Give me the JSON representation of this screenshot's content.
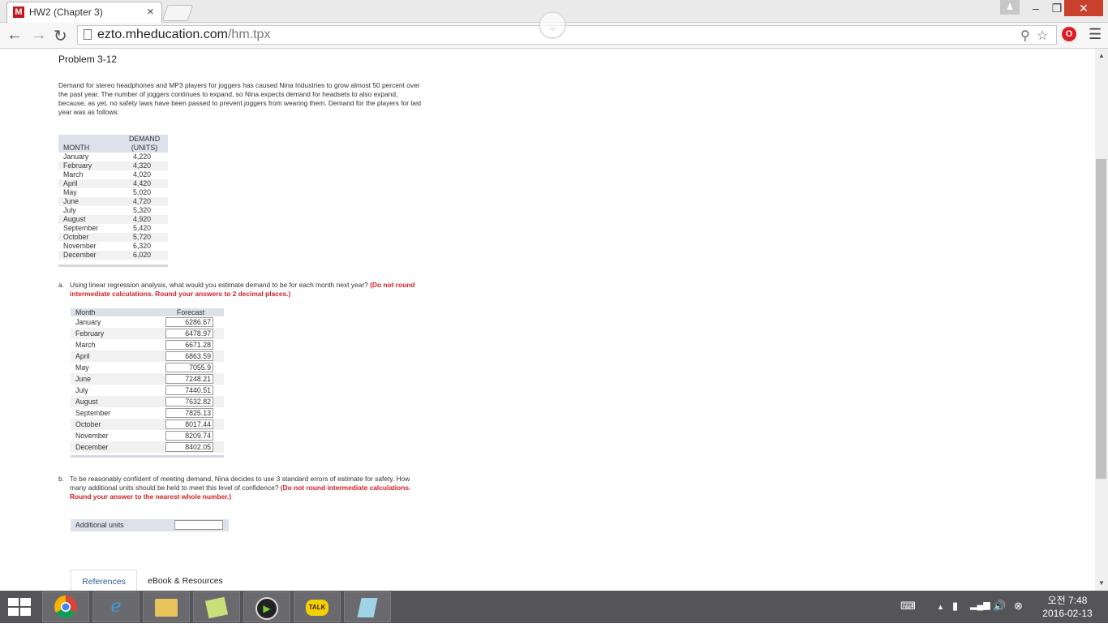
{
  "browser": {
    "tab_title": "HW2 (Chapter 3)",
    "tab_favicon": "M",
    "close_glyph": "×",
    "url_host": "ezto.mheducation.com",
    "url_path": "/hm.tpx"
  },
  "problem": {
    "title": "Problem 3-12",
    "intro": "Demand for stereo headphones and MP3 players for joggers has caused Nina Industries to grow almost 50 percent over the past year. The number of joggers continues to expand, so Nina expects demand for headsets to also expand, because, as yet, no safety laws have been passed to prevent joggers from wearing them. Demand for the players for last year was as follows:"
  },
  "demand_table": {
    "col_month": "MONTH",
    "col_demand_1": "DEMAND",
    "col_demand_2": "(UNITS)",
    "rows": [
      {
        "month": "January",
        "units": "4,220"
      },
      {
        "month": "February",
        "units": "4,320"
      },
      {
        "month": "March",
        "units": "4,020"
      },
      {
        "month": "April",
        "units": "4,420"
      },
      {
        "month": "May",
        "units": "5,020"
      },
      {
        "month": "June",
        "units": "4,720"
      },
      {
        "month": "July",
        "units": "5,320"
      },
      {
        "month": "August",
        "units": "4,920"
      },
      {
        "month": "September",
        "units": "5,420"
      },
      {
        "month": "October",
        "units": "5,720"
      },
      {
        "month": "November",
        "units": "6,320"
      },
      {
        "month": "December",
        "units": "6,020"
      }
    ]
  },
  "part_a": {
    "letter": "a.",
    "question": "Using linear regression analysis, what would you estimate demand to be for each month next year?",
    "instruction": "(Do not round intermediate calculations. Round your answers to 2 decimal places.)",
    "col_month": "Month",
    "col_forecast": "Forecast",
    "rows": [
      {
        "month": "January",
        "forecast": "6286.67"
      },
      {
        "month": "February",
        "forecast": "6478.97"
      },
      {
        "month": "March",
        "forecast": "6671.28"
      },
      {
        "month": "April",
        "forecast": "6863.59"
      },
      {
        "month": "May",
        "forecast": "7055.9"
      },
      {
        "month": "June",
        "forecast": "7248.21"
      },
      {
        "month": "July",
        "forecast": "7440.51"
      },
      {
        "month": "August",
        "forecast": "7632.82"
      },
      {
        "month": "September",
        "forecast": "7825.13"
      },
      {
        "month": "October",
        "forecast": "8017.44"
      },
      {
        "month": "November",
        "forecast": "8209.74"
      },
      {
        "month": "December",
        "forecast": "8402.05"
      }
    ]
  },
  "part_b": {
    "letter": "b.",
    "question": "To be reasonably confident of meeting demand, Nina decides to use 3 standard errors of estimate for safety. How many additional units should be held to meet this level of confidence?",
    "instruction": "(Do not round intermediate calculations. Round your answer to the nearest whole number.)",
    "field_label": "Additional units",
    "field_value": ""
  },
  "bottom_tabs": {
    "references": "References",
    "ebook": "eBook & Resources"
  },
  "taskbar": {
    "time": "오전 7:48",
    "date": "2016-02-13",
    "talk_label": "TALK"
  },
  "colors": {
    "accent_red": "#d31f26",
    "table_header": "#dde1ea",
    "taskbar": "#555558"
  }
}
